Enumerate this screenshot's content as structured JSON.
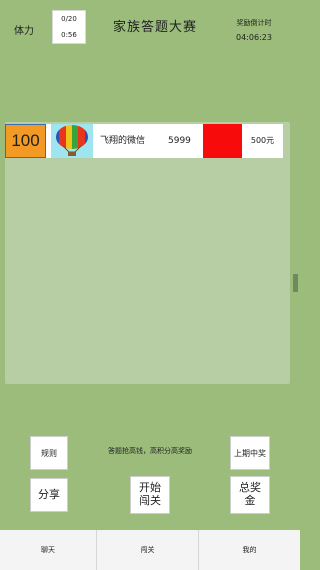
{
  "header": {
    "stamina_label": "体力",
    "stamina_current": "0/20",
    "stamina_timer": "0:56",
    "title": "家族答题大赛",
    "countdown_label": "奖励倒计时",
    "countdown_value": "04:06:23"
  },
  "leaderboard": {
    "rows": [
      {
        "rank": "100",
        "name": "飞翔的微信",
        "score": "5999",
        "prize": "500元"
      }
    ]
  },
  "controls": {
    "rules_label": "规则",
    "hint": "答题抢高钱，高积分高奖励",
    "last_winners_label": "上期中奖",
    "share_label": "分享",
    "start_label": "开始\n闯关",
    "prize_pool_label": "总奖\n金"
  },
  "tabs": [
    "聊天",
    "闯关",
    "我的"
  ],
  "colors": {
    "background": "#9bbc7b",
    "rank_badge": "#f39a25",
    "red_block": "#f70b0b",
    "balloon_bg": "#9fe5f0"
  },
  "icons": {
    "balloon": "hot-air-balloon-icon"
  }
}
